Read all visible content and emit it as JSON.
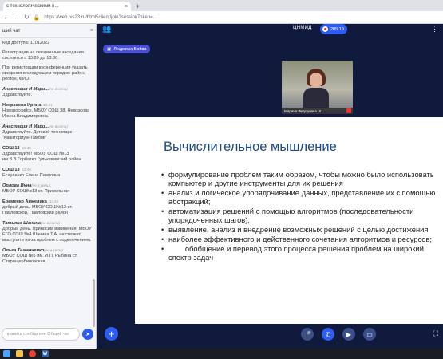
{
  "browser": {
    "tab_title": "с технологическими н...",
    "url": "https://web.ivs23.ru/html5client/join?sessionToken=...",
    "new_tab": "+"
  },
  "chat": {
    "header": "щий чат",
    "close": "×",
    "input_placeholder": "править сообщение Общий чат",
    "messages": [
      {
        "name": "",
        "time": "",
        "text": "Код доступа: 11012022"
      },
      {
        "name": "",
        "time": "",
        "text": "Регистрация на секционные заседания состоится с 13.20 до 13.30."
      },
      {
        "name": "",
        "time": "",
        "text": "При регистрации в конференции указать сведения в следующем порядке: район/регион, ФИО."
      },
      {
        "name": "Анастасия И Мари...",
        "time": "",
        "meta": "(не в сети)",
        "text": "Здравствуйте."
      },
      {
        "name": "Некрасова Ирина",
        "time": "13:21",
        "text": "Новороссийск, МБОУ СОШ 38, Некрасова Ирина Владимировна."
      },
      {
        "name": "Анастасия И Мари...",
        "time": "",
        "meta": "(не в сети)",
        "text": "Здравствуйте. Детский технопарк \"Кванториум-Тамбов\""
      },
      {
        "name": "СОШ 13",
        "time": "13:45",
        "text": "Здравствуйте! МБОУ СОШ №13 им.В.В.Горбатко Гулькевичский район"
      },
      {
        "name": "СОШ 13",
        "time": "13:46",
        "text": "Есауленко Елена Павловна"
      },
      {
        "name": "Орлова Инна",
        "time": "",
        "meta": "(не в сети)",
        "text": "МБОУ СОШ№13 ст. Привольная"
      },
      {
        "name": "Еременко Анжелика",
        "time": "13:46",
        "text": "добрый день. МБОУ СОШ№12 ст. Павловской, Павловский район"
      },
      {
        "name": "Татьяна Шанина",
        "time": "",
        "meta": "(не в сети)",
        "text": "Добрый день. Приносим извинения, МБОУ ЕГО СОШ №4 Шанина Т.А. не сможет выступить из-за проблем с подключением."
      },
      {
        "name": "Ольга Тыганченко",
        "time": "",
        "meta": "(не в сети)",
        "text": "МБОУ СОШ №5 им. И.П. Рыбина ст. Старощербиновская"
      }
    ]
  },
  "meeting": {
    "room_title": "ЦНМИД",
    "record_time": "205:19",
    "presenter_name": "Людмила Бойва",
    "video_caption": "Марина Федоровна Ш...",
    "slide": {
      "title": "Вычислительное мышление",
      "bullets": [
        "формулирование проблем таким образом, чтобы можно было использовать компьютер и другие инструменты для их решения",
        "анализ и логическое упорядочивание данных, представление их с помощью абстракций;",
        "автоматизация решений с помощью алгоритмов (последовательности упорядоченных шагов);",
        "выявление, анализ и внедрение возможных решений с целью достижения",
        "наиболее эффективного и действенного сочетания алгоритмов и ресурсов;",
        "        обобщение и перевод этого процесса решения проблем на широкий спектр задач"
      ]
    }
  },
  "colors": {
    "accent": "#2e5cf2",
    "background": "#0f1a3d",
    "slide_title": "#1f4a8a"
  },
  "icons": [
    "users-icon",
    "menu-dots-icon",
    "mic-icon",
    "phone-icon",
    "camera-icon",
    "screen-share-icon",
    "plus-icon",
    "send-icon",
    "layout-icon"
  ]
}
